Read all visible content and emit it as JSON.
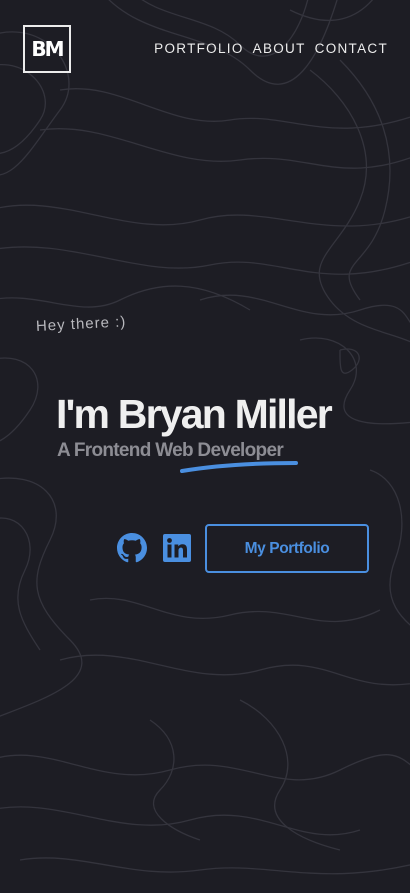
{
  "header": {
    "logo_text": "BM",
    "nav": [
      {
        "label": "PORTFOLIO"
      },
      {
        "label": "ABOUT"
      },
      {
        "label": "CONTACT"
      }
    ]
  },
  "hero": {
    "greeting": "Hey there :)",
    "name": "I'm Bryan Miller",
    "role": "A Frontend Web Developer"
  },
  "actions": {
    "github_icon": "github-icon",
    "linkedin_icon": "linkedin-icon",
    "portfolio_button": "My Portfolio"
  },
  "colors": {
    "background": "#1d1d24",
    "accent": "#4a8fe0",
    "text": "#efefef",
    "muted": "#8d8d94"
  }
}
